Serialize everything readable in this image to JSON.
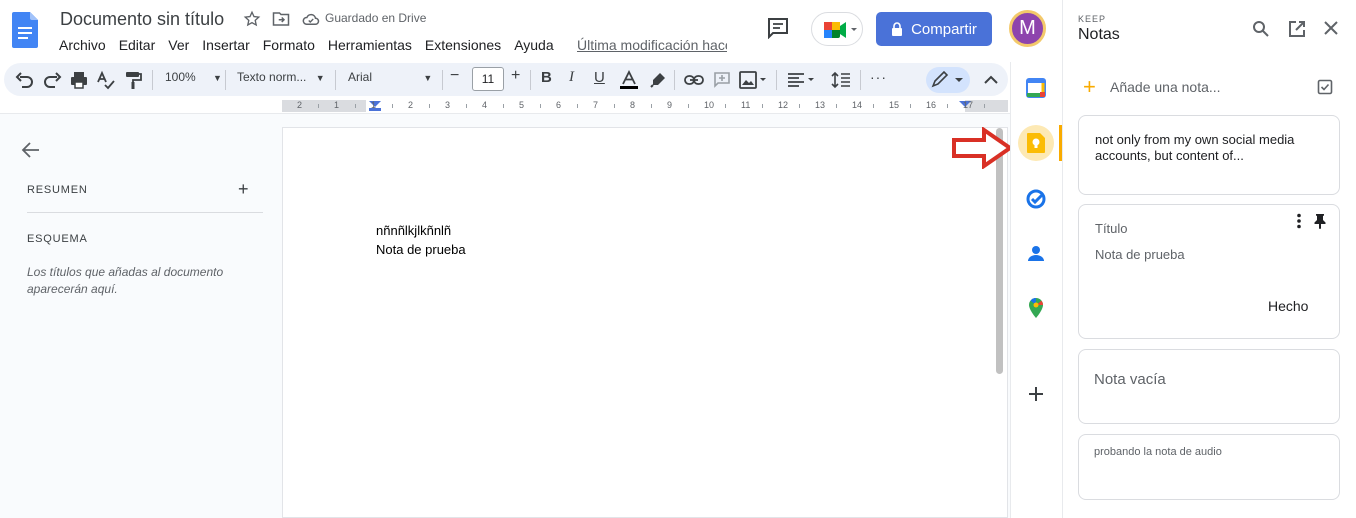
{
  "app": {
    "doc_title": "Documento sin título",
    "saved_status": "Guardado en Drive",
    "last_modified": "Última modificación hace",
    "share_label": "Compartir",
    "avatar_initial": "M"
  },
  "menu": [
    "Archivo",
    "Editar",
    "Ver",
    "Insertar",
    "Formato",
    "Herramientas",
    "Extensiones",
    "Ayuda"
  ],
  "toolbar": {
    "zoom": "100%",
    "style": "Texto norm...",
    "font": "Arial",
    "font_size": "11",
    "more": "···"
  },
  "ruler": {
    "marks": [
      "2",
      "1",
      "1",
      "2",
      "3",
      "4",
      "5",
      "6",
      "7",
      "8",
      "9",
      "10",
      "11",
      "12",
      "13",
      "14",
      "15",
      "16",
      "17"
    ]
  },
  "outline": {
    "summary_label": "RESUMEN",
    "summary_add": "+",
    "outline_label": "ESQUEMA",
    "hint": "Los títulos que añadas al documento aparecerán aquí."
  },
  "document": {
    "lines": [
      "nñnñlkjlkñnlñ",
      "Nota de prueba"
    ]
  },
  "keep": {
    "label_small": "KEEP",
    "title": "Notas",
    "add_note": "Añade una nota...",
    "notes": [
      {
        "text": "not only from my own social media accounts, but content of..."
      },
      {
        "title": "Título",
        "body": "Nota de prueba",
        "action": "Hecho"
      },
      {
        "text": "Nota vacía"
      },
      {
        "text": "probando la nota de audio"
      }
    ]
  },
  "colors": {
    "accent_blue": "#4a72d8",
    "keep_yellow": "#f9ab00",
    "avatar_purple": "#8e44ad",
    "annotation_red": "#d93025"
  }
}
